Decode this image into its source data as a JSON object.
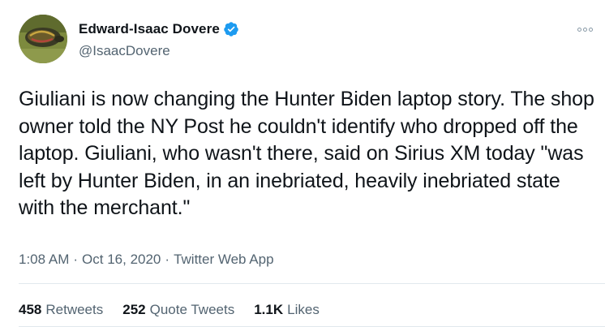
{
  "author": {
    "display_name": "Edward-Isaac Dovere",
    "handle": "@IsaacDovere",
    "verified_badge_icon": "verified-badge-icon",
    "avatar_icon": "avatar-turtle-photo"
  },
  "more_icon": "more-options-icon",
  "tweet": {
    "text": "Giuliani is now changing the Hunter Biden laptop story. The shop owner told the NY Post he couldn't identify who dropped off the laptop. Giuliani, who wasn't there, said on Sirius XM today \"was left by Hunter Biden, in an inebriated, heavily inebriated state with the merchant.\""
  },
  "meta": {
    "time": "1:08 AM",
    "separator": "·",
    "date": "Oct 16, 2020",
    "source": "Twitter Web App"
  },
  "stats": {
    "retweets_count": "458",
    "retweets_label": "Retweets",
    "quote_tweets_count": "252",
    "quote_tweets_label": "Quote Tweets",
    "likes_count": "1.1K",
    "likes_label": "Likes"
  },
  "colors": {
    "text_primary": "#0f1419",
    "text_secondary": "#536471",
    "verified_blue": "#1d9bf0",
    "divider": "#e1e8ed"
  }
}
